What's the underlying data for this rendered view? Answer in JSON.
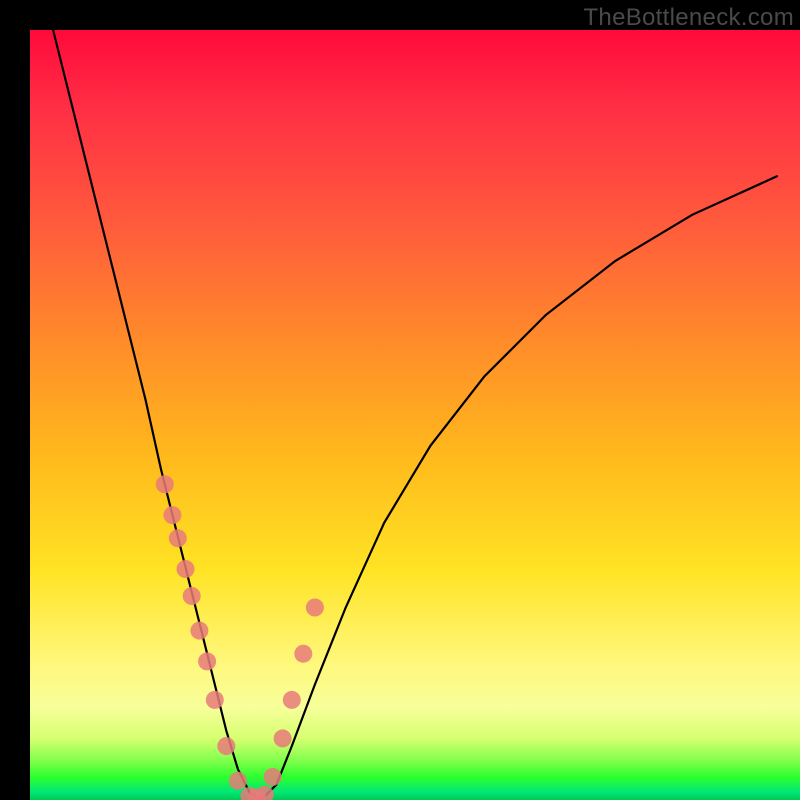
{
  "watermark": "TheBottleneck.com",
  "chart_data": {
    "type": "line",
    "title": "",
    "xlabel": "",
    "ylabel": "",
    "xlim": [
      0,
      100
    ],
    "ylim": [
      0,
      100
    ],
    "series": [
      {
        "name": "bottleneck-curve",
        "x": [
          3,
          6,
          9,
          12,
          15,
          17,
          19,
          21,
          22.5,
          24,
          25.5,
          27,
          28.5,
          30,
          32,
          34,
          37,
          41,
          46,
          52,
          59,
          67,
          76,
          86,
          97
        ],
        "values": [
          100,
          88,
          76,
          64,
          52,
          43,
          35,
          27,
          21,
          15,
          9,
          4,
          1,
          0,
          2,
          7,
          15,
          25,
          36,
          46,
          55,
          63,
          70,
          76,
          81
        ]
      }
    ],
    "markers": {
      "name": "highlighted-points",
      "color": "#e77a7a",
      "radius_px": 9,
      "x": [
        17.5,
        18.5,
        19.2,
        20.2,
        21.0,
        22.0,
        23.0,
        24.0,
        25.5,
        27.0,
        28.5,
        29.5,
        30.5,
        31.5,
        32.8,
        34.0,
        35.5,
        37.0
      ],
      "values": [
        41,
        37,
        34,
        30,
        26.5,
        22,
        18,
        13,
        7,
        2.5,
        0.5,
        0.3,
        0.7,
        3,
        8,
        13,
        19,
        25
      ]
    },
    "gradient_stops": [
      {
        "pos": 0.0,
        "color": "#ff0a3a"
      },
      {
        "pos": 0.25,
        "color": "#ff5a3c"
      },
      {
        "pos": 0.55,
        "color": "#ffb81c"
      },
      {
        "pos": 0.82,
        "color": "#fff77a"
      },
      {
        "pos": 0.95,
        "color": "#7dff4a"
      },
      {
        "pos": 1.0,
        "color": "#00c853"
      }
    ]
  }
}
